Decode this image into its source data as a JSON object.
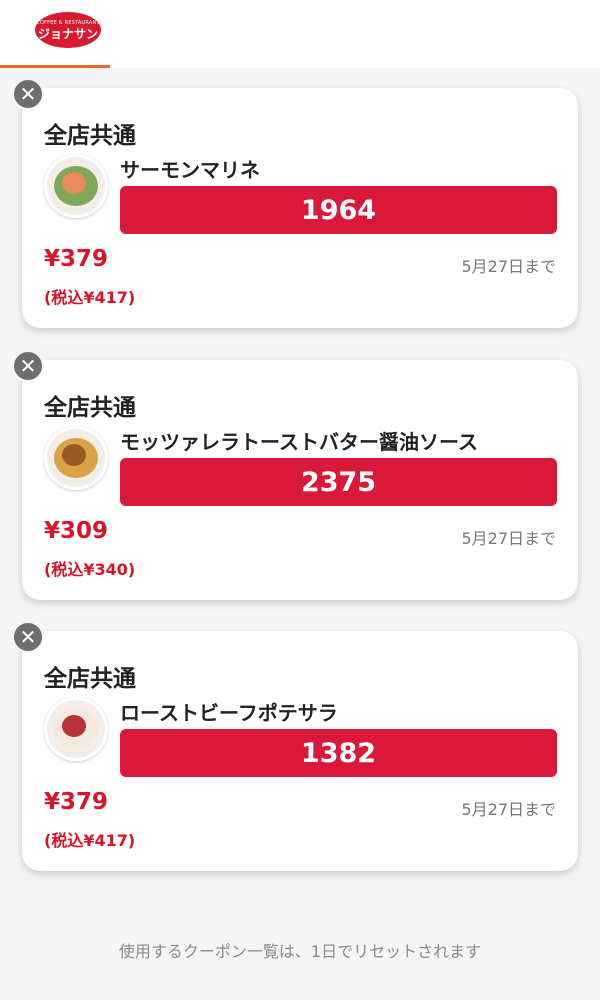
{
  "header": {
    "logo_top_text": "COFFEE & RESTAURANT",
    "logo_main_text": "ジョナサン",
    "active_tab_color": "#e8682b"
  },
  "coupons": [
    {
      "store": "全店共通",
      "item": "サーモンマリネ",
      "code": "1964",
      "price": "¥379",
      "price_tax": "(税込¥417)",
      "expiry": "5月27日まで",
      "icon": "salad-icon"
    },
    {
      "store": "全店共通",
      "item": "モッツァレラトーストバター醤油ソース",
      "code": "2375",
      "price": "¥309",
      "price_tax": "(税込¥340)",
      "expiry": "5月27日まで",
      "icon": "toast-icon"
    },
    {
      "store": "全店共通",
      "item": "ローストビーフポテサラ",
      "code": "1382",
      "price": "¥379",
      "price_tax": "(税込¥417)",
      "expiry": "5月27日まで",
      "icon": "roast-beef-icon"
    }
  ],
  "close_symbol": "✕",
  "footer_note": "使用するクーポン一覧は、1日でリセットされます",
  "colors": {
    "code_button": "#d8193a",
    "price": "#d6152c",
    "brand": "#d8192e"
  }
}
